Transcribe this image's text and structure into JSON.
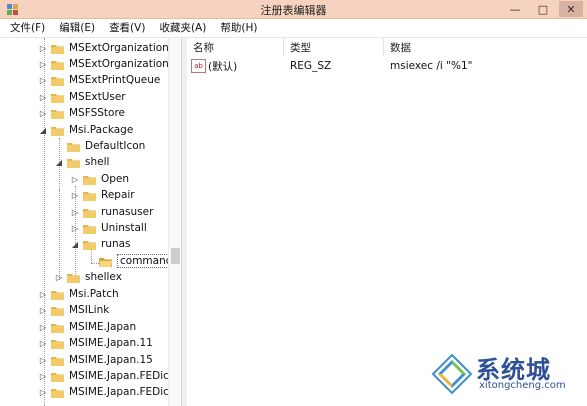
{
  "window": {
    "title": "注册表编辑器",
    "buttons": [
      "—",
      "□",
      "✕"
    ]
  },
  "menu": [
    "文件(F)",
    "编辑(E)",
    "查看(V)",
    "收藏夹(A)",
    "帮助(H)"
  ],
  "tree": {
    "nodes": [
      {
        "label": "MSExtOrganization",
        "toggle": "▷"
      },
      {
        "label": "MSExtOrganizationU",
        "toggle": "▷"
      },
      {
        "label": "MSExtPrintQueue",
        "toggle": "▷"
      },
      {
        "label": "MSExtUser",
        "toggle": "▷"
      },
      {
        "label": "MSFSStore",
        "toggle": "▷"
      },
      {
        "label": "Msi.Package",
        "toggle": "◢"
      },
      {
        "label": "DefaultIcon",
        "toggle": ""
      },
      {
        "label": "shell",
        "toggle": "◢"
      },
      {
        "label": "Open",
        "toggle": "▷"
      },
      {
        "label": "Repair",
        "toggle": "▷"
      },
      {
        "label": "runasuser",
        "toggle": "▷"
      },
      {
        "label": "Uninstall",
        "toggle": "▷"
      },
      {
        "label": "runas",
        "toggle": "◢"
      },
      {
        "label": "command",
        "toggle": ""
      },
      {
        "label": "shellex",
        "toggle": "▷"
      },
      {
        "label": "Msi.Patch",
        "toggle": "▷"
      },
      {
        "label": "MSILink",
        "toggle": "▷"
      },
      {
        "label": "MSIME.Japan",
        "toggle": "▷"
      },
      {
        "label": "MSIME.Japan.11",
        "toggle": "▷"
      },
      {
        "label": "MSIME.Japan.15",
        "toggle": "▷"
      },
      {
        "label": "MSIME.Japan.FEDict",
        "toggle": "▷"
      },
      {
        "label": "MSIME.Japan.FEDict.",
        "toggle": "▷"
      }
    ]
  },
  "list": {
    "headers": [
      "名称",
      "类型",
      "数据"
    ],
    "rows": [
      {
        "name": "(默认)",
        "type": "REG_SZ",
        "data": "msiexec /i \"%1\"",
        "icon": "ab"
      }
    ]
  },
  "watermark": {
    "brand": "系统城",
    "site": "xitongcheng.com"
  },
  "colors": {
    "titlebar": "#f6d2bf",
    "folder": "#e6b54a",
    "accent": "#2f4f96"
  }
}
